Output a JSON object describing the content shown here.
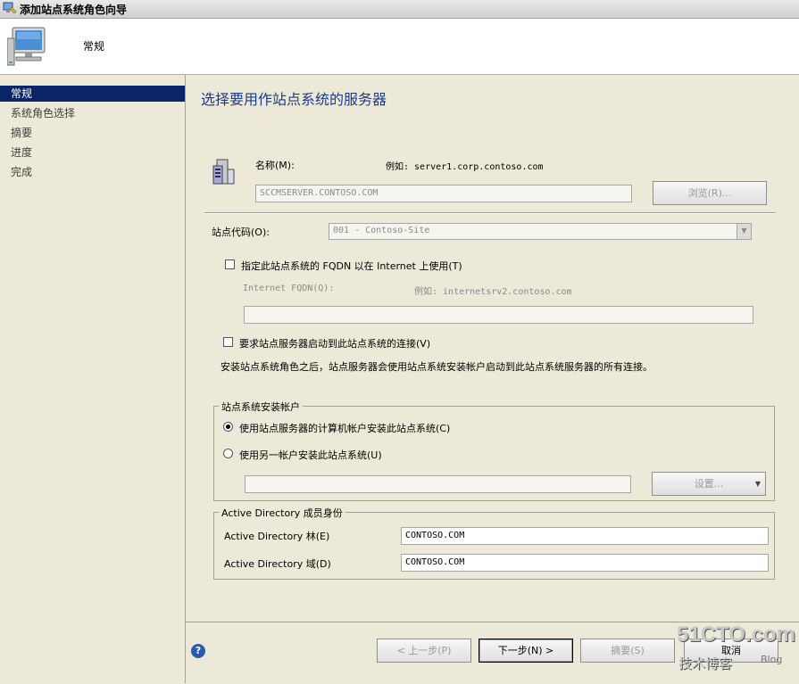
{
  "window": {
    "title": "添加站点系统角色向导"
  },
  "header": {
    "title": "常规"
  },
  "sidebar": {
    "items": [
      {
        "label": "常规",
        "active": true
      },
      {
        "label": "系统角色选择",
        "active": false
      },
      {
        "label": "摘要",
        "active": false
      },
      {
        "label": "进度",
        "active": false
      },
      {
        "label": "完成",
        "active": false
      }
    ]
  },
  "main": {
    "title": "选择要用作站点系统的服务器",
    "name_label": "名称(M):",
    "name_example": "例如: server1.corp.contoso.com",
    "name_value": "SCCMSERVER.CONTOSO.COM",
    "browse_button": "浏览(R)...",
    "site_code_label": "站点代码(O):",
    "site_code_value": "001 - Contoso-Site",
    "fqdn_checkbox": {
      "label": "指定此站点系统的 FQDN 以在 Internet 上使用(T)",
      "checked": false
    },
    "internet_fqdn_label": "Internet FQDN(Q):",
    "internet_fqdn_example": "例如: internetsrv2.contoso.com",
    "internet_fqdn_value": "",
    "require_checkbox": {
      "label": "要求站点服务器启动到此站点系统的连接(V)",
      "checked": false
    },
    "require_note": "安装站点系统角色之后，站点服务器会使用站点系统安装帐户启动到此站点系统服务器的所有连接。",
    "install_account_group": {
      "caption": "站点系统安装帐户",
      "option1": {
        "label": "使用站点服务器的计算机帐户安装此站点系统(C)",
        "selected": true
      },
      "option2": {
        "label": "使用另一帐户安装此站点系统(U)",
        "selected": false
      },
      "account_value": "",
      "settings_button": "设置..."
    },
    "ad_group": {
      "caption": "Active Directory 成员身份",
      "forest_label": "Active Directory 林(E)",
      "forest_value": "CONTOSO.COM",
      "domain_label": "Active Directory 域(D)",
      "domain_value": "CONTOSO.COM"
    }
  },
  "footer": {
    "prev_button": "< 上一步(P)",
    "next_button": "下一步(N) >",
    "summary_button": "摘要(S)",
    "cancel_button": "取消"
  },
  "watermark": {
    "text1": "51CTO.com",
    "text2": "技术博客",
    "text3": "Blog"
  }
}
